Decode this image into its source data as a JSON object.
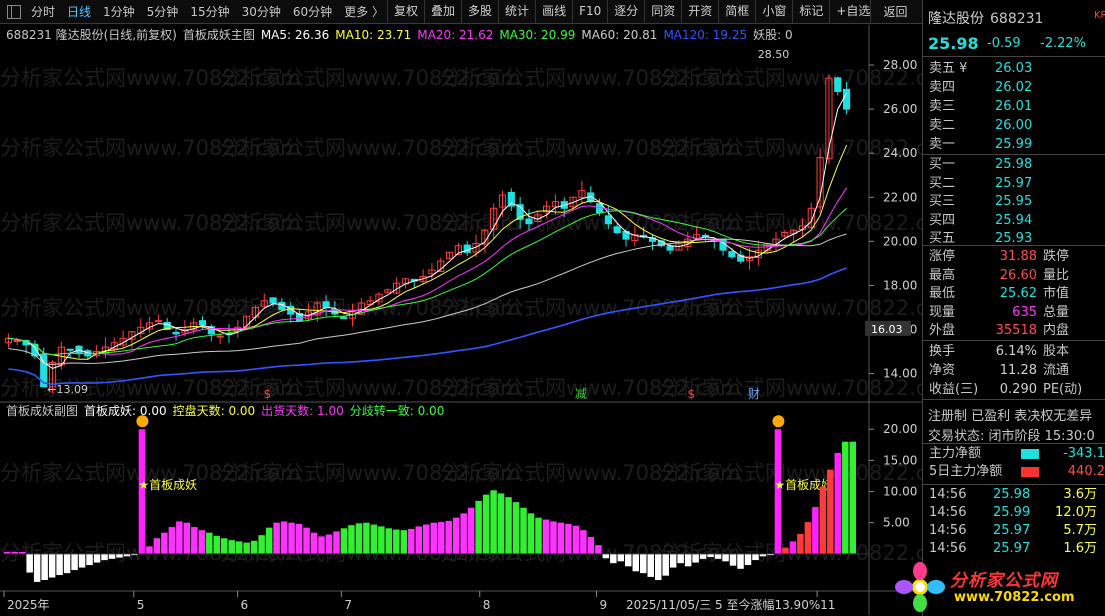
{
  "toolbar": {
    "periods": [
      "分时",
      "日线",
      "1分钟",
      "5分钟",
      "15分钟",
      "30分钟",
      "60分钟",
      "更多 〉"
    ],
    "active_period": "日线",
    "tools": [
      "复权",
      "叠加",
      "多股",
      "统计",
      "画线",
      "F10",
      "逐分",
      "同资",
      "开资",
      "简框",
      "小窗",
      "标记",
      "+自选"
    ],
    "back": "返回"
  },
  "main_legend": {
    "stock": "688231 隆达股份(日线,前复权)",
    "indicator": "首板成妖主图",
    "ma": [
      {
        "label": "MA5: 26.36",
        "color": "#ffffff"
      },
      {
        "label": "MA10: 23.71",
        "color": "#ffff33"
      },
      {
        "label": "MA20: 21.62",
        "color": "#ff33ff"
      },
      {
        "label": "MA30: 20.99",
        "color": "#33ff33"
      },
      {
        "label": "MA60: 20.81",
        "color": "#cccccc"
      },
      {
        "label": "MA120: 19.25",
        "color": "#3355ff"
      }
    ],
    "extra": "妖股: 0"
  },
  "sub_legend": {
    "name": "首板成妖副图",
    "items": [
      {
        "label": "首板成妖: 0.00",
        "color": "#ffffff"
      },
      {
        "label": "控盘天数: 0.00",
        "color": "#ffff33"
      },
      {
        "label": "出货天数: 1.00",
        "color": "#ff33ff"
      },
      {
        "label": "分歧转一致: 0.00",
        "color": "#33ff33"
      }
    ]
  },
  "chart_data": [
    {
      "type": "candlestick",
      "title": "688231 隆达股份(日线,前复权)",
      "y_ticks": [
        14.0,
        16.0,
        18.0,
        20.0,
        22.0,
        24.0,
        26.0,
        28.0
      ],
      "ylim": [
        12.8,
        29.0
      ],
      "x_ticks": [
        "2025年",
        "5",
        "6",
        "7",
        "8",
        "9",
        "11"
      ],
      "annotations": [
        "28.50",
        "13.09",
        "16.03"
      ],
      "markers": [
        {
          "text": "$",
          "color": "#ff4040"
        },
        {
          "text": "减",
          "color": "#33dd33"
        },
        {
          "text": "$",
          "color": "#ff4040"
        },
        {
          "text": "财",
          "color": "#66aaff"
        }
      ],
      "price_path": [
        15.6,
        15.5,
        15.3,
        14.8,
        13.4,
        14.5,
        15.2,
        15.1,
        14.9,
        14.8,
        15.0,
        15.2,
        15.4,
        15.6,
        15.9,
        16.1,
        16.3,
        16.4,
        16.0,
        15.8,
        16.0,
        16.3,
        16.2,
        15.8,
        15.7,
        15.8,
        16.1,
        16.6,
        17.0,
        17.3,
        17.2,
        16.9,
        16.7,
        16.4,
        16.8,
        17.2,
        17.0,
        16.7,
        16.5,
        16.8,
        17.2,
        17.3,
        17.6,
        17.8,
        18.1,
        18.3,
        18.2,
        18.4,
        18.7,
        19.1,
        19.5,
        19.8,
        19.5,
        19.9,
        20.5,
        21.5,
        22.1,
        21.6,
        21.0,
        20.8,
        21.2,
        21.6,
        21.8,
        21.5,
        22.0,
        22.3,
        21.8,
        21.3,
        20.8,
        20.4,
        20.1,
        20.3,
        20.2,
        20.0,
        19.8,
        19.6,
        19.9,
        20.1,
        20.3,
        20.2,
        20.0,
        19.6,
        19.3,
        19.1,
        19.3,
        19.6,
        19.9,
        20.1,
        20.4,
        20.5,
        20.7,
        21.5,
        23.8,
        27.4,
        26.8,
        26.0
      ],
      "ma_series": [
        {
          "name": "MA5",
          "color": "#ffffff"
        },
        {
          "name": "MA10",
          "color": "#ffff33"
        },
        {
          "name": "MA20",
          "color": "#ff33ff"
        },
        {
          "name": "MA30",
          "color": "#33ff33"
        },
        {
          "name": "MA60",
          "color": "#cccccc"
        },
        {
          "name": "MA120",
          "color": "#3355ff"
        }
      ]
    },
    {
      "type": "bar",
      "title": "首板成妖副图",
      "y_ticks": [
        5.0,
        10.0,
        15.0,
        20.0
      ],
      "ylim": [
        -5,
        21
      ],
      "labels": [
        "★首板成妖",
        "★首板成妖"
      ],
      "values": [
        0.3,
        0.3,
        0.3,
        -3.0,
        -4.5,
        -4.2,
        -3.8,
        -3.4,
        -3.1,
        -2.6,
        -2.2,
        -1.8,
        -1.4,
        -1.0,
        -0.8,
        -0.6,
        -0.4,
        -0.2,
        20,
        1.2,
        2.5,
        3.4,
        4.3,
        5.2,
        5.0,
        4.3,
        3.8,
        3.4,
        2.9,
        2.5,
        2.2,
        2.0,
        1.8,
        2.1,
        3.0,
        4.2,
        5.0,
        5.2,
        5.0,
        4.8,
        4.2,
        3.4,
        2.8,
        3.1,
        3.6,
        4.1,
        4.6,
        4.9,
        5.0,
        4.7,
        4.4,
        4.1,
        3.9,
        3.8,
        4.0,
        4.4,
        4.7,
        5.0,
        5.1,
        5.3,
        5.8,
        6.5,
        7.4,
        8.5,
        9.5,
        10.2,
        9.7,
        9.1,
        8.3,
        7.4,
        6.5,
        5.8,
        5.5,
        5.2,
        5.0,
        4.8,
        4.5,
        3.8,
        2.7,
        1.4,
        -0.7,
        -1.5,
        -1.2,
        -2.0,
        -2.8,
        -3.1,
        -3.7,
        -4.2,
        -3.5,
        -2.2,
        -1.5,
        -2.0,
        -1.4,
        -0.8,
        -0.5,
        -0.8,
        -1.2,
        -1.9,
        -2.4,
        -1.8,
        -1.0,
        -0.4,
        -0.2,
        20,
        1.0,
        2.0,
        3.2,
        5.1,
        7.5,
        10.8,
        13.5,
        16.2,
        18.0,
        18.0
      ],
      "colors_hint": "negative=#ffffff, positive alternating #ff33ff/#33ee33, signal=#ff22ff"
    }
  ],
  "quote": {
    "name": "隆达股份",
    "code": "688231",
    "market_badge": "KR",
    "price": "25.98",
    "change": "-0.59",
    "pct": "-2.22%",
    "ask": [
      {
        "label": "卖五",
        "val": "26.03",
        "mark": "¥"
      },
      {
        "label": "卖四",
        "val": "26.02"
      },
      {
        "label": "卖三",
        "val": "26.01"
      },
      {
        "label": "卖二",
        "val": "26.00"
      },
      {
        "label": "卖一",
        "val": "25.99"
      }
    ],
    "bid": [
      {
        "label": "买一",
        "val": "25.98"
      },
      {
        "label": "买二",
        "val": "25.97"
      },
      {
        "label": "买三",
        "val": "25.95"
      },
      {
        "label": "买四",
        "val": "25.94"
      },
      {
        "label": "买五",
        "val": "25.93"
      }
    ],
    "stats": [
      {
        "k1": "涨停",
        "v1": "31.88",
        "c1": "#ff4a4a",
        "k2": "跌停"
      },
      {
        "k1": "最高",
        "v1": "26.60",
        "c1": "#ff4a4a",
        "k2": "量比"
      },
      {
        "k1": "最低",
        "v1": "25.62",
        "c1": "#1ee0e0",
        "k2": "市值"
      },
      {
        "k1": "现量",
        "v1": "635",
        "c1": "#ff33ff",
        "k2": "总量"
      },
      {
        "k1": "外盘",
        "v1": "35518",
        "c1": "#ff4a4a",
        "k2": "内盘"
      },
      {
        "k1": "换手",
        "v1": "6.14%",
        "c1": "#d0d0d0",
        "k2": "股本"
      },
      {
        "k1": "净资",
        "v1": "11.28",
        "c1": "#d0d0d0",
        "k2": "流通"
      },
      {
        "k1": "收益(三)",
        "v1": "0.290",
        "c1": "#d0d0d0",
        "k2": "PE(动)"
      }
    ],
    "tags": "注册制 已盈利 表决权无差异",
    "trade_state": "交易状态: 闭市阶段 15:30:0",
    "flow": [
      {
        "k": "主力净额",
        "v": "-343.1",
        "bar": "#1ee0e0",
        "c": "#1ee0e0"
      },
      {
        "k": "5日主力净额",
        "v": "440.2",
        "bar": "#ff3030",
        "c": "#ff4a4a"
      }
    ],
    "ticks": [
      {
        "t": "14:56",
        "p": "25.98",
        "v": "3.6万",
        "c": "#ffff44"
      },
      {
        "t": "14:56",
        "p": "25.99",
        "v": "12.0万",
        "c": "#ffff44"
      },
      {
        "t": "14:56",
        "p": "25.97",
        "v": "5.7万",
        "c": "#ffff44"
      },
      {
        "t": "14:56",
        "p": "25.97",
        "v": "1.6万",
        "c": "#ffff44"
      }
    ]
  },
  "status_bar": {
    "text": "2025/11/05/三 5 至今涨幅13.90%"
  },
  "logo": {
    "line1": "分析家公式网",
    "line2": "www.70822.com"
  },
  "watermark": "分析家公式网www.70822.com"
}
